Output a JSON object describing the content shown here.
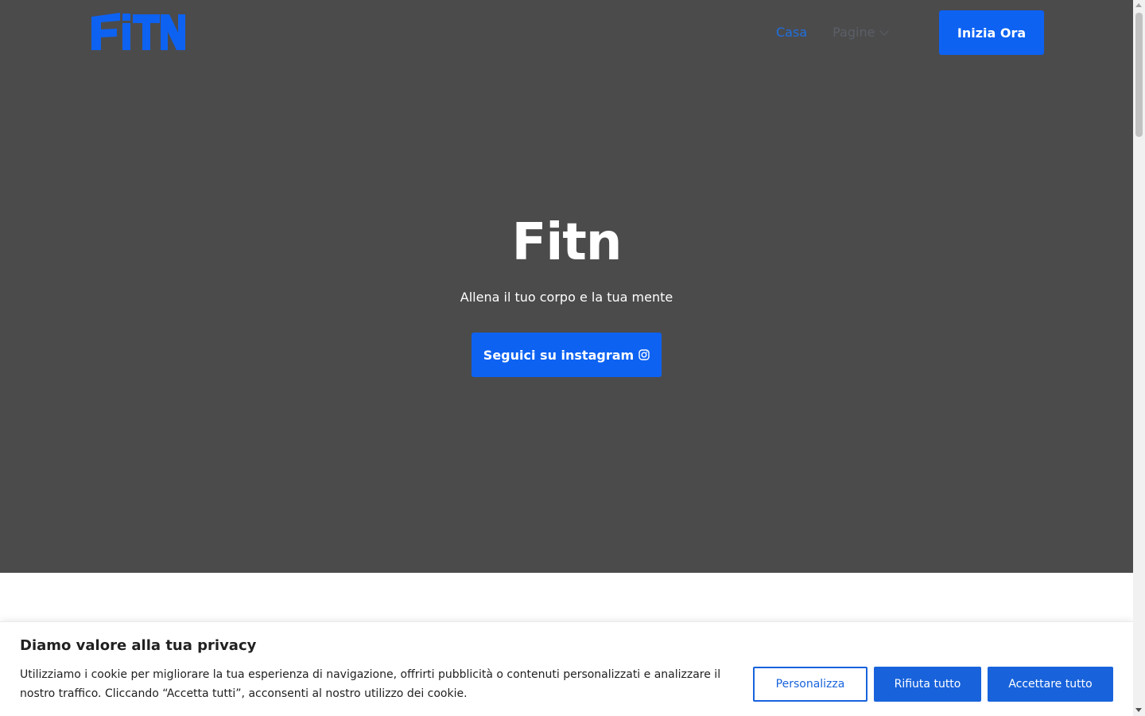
{
  "brand": {
    "logo_text": "FiTN",
    "accent_color": "#0d62f2"
  },
  "nav": {
    "home_label": "Casa",
    "pages_label": "Pagine",
    "pages_icon": "chevron-down-icon",
    "cta_label": "Inizia Ora"
  },
  "hero": {
    "title": "Fitn",
    "subtitle": "Allena il tuo corpo e la tua mente",
    "cta_label": "Seguici su instagram",
    "cta_icon": "instagram-icon",
    "background_color": "#4b4b4c"
  },
  "cookie_banner": {
    "title": "Diamo valore alla tua privacy",
    "text": "Utilizziamo i cookie per migliorare la tua esperienza di navigazione, offrirti pubblicità o contenuti personalizzati e analizzare il nostro traffico. Cliccando “Accetta tutti”, acconsenti al nostro utilizzo dei cookie.",
    "customize_label": "Personalizza",
    "reject_label": "Rifiuta tutto",
    "accept_label": "Accettare tutto",
    "button_color": "#1863dc"
  }
}
